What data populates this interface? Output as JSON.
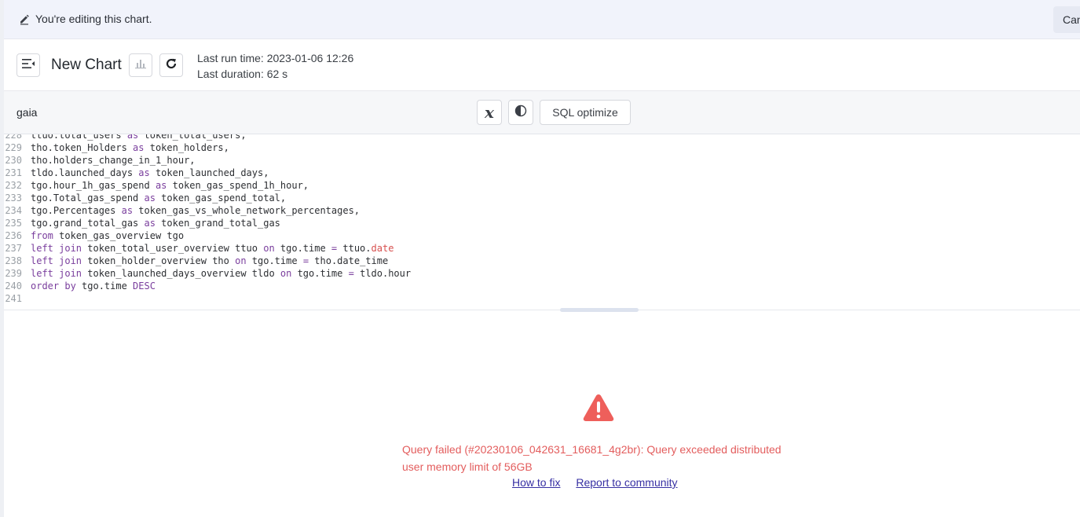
{
  "banner": {
    "text": "You're editing this chart.",
    "cancel_label": "Cancel",
    "icon": "pencil-icon"
  },
  "header": {
    "title": "New Chart",
    "last_run_time": "Last run time: 2023-01-06 12:26",
    "last_duration": "Last duration: 62 s",
    "icons": [
      "sidebar-toggle-icon",
      "bar-chart-icon",
      "refresh-icon"
    ]
  },
  "editor": {
    "database": "gaia",
    "variables_button": "x",
    "theme_button": "contrast-icon",
    "sql_optimize_label": "SQL optimize",
    "lines": [
      {
        "num": "228",
        "tokens": [
          {
            "t": "ttuo.total_users "
          },
          {
            "t": "as",
            "k": "kw"
          },
          {
            "t": " token_total_users,"
          }
        ]
      },
      {
        "num": "229",
        "tokens": [
          {
            "t": "tho.token_Holders "
          },
          {
            "t": "as",
            "k": "kw"
          },
          {
            "t": " token_holders,"
          }
        ]
      },
      {
        "num": "230",
        "tokens": [
          {
            "t": "tho.holders_change_in_1_hour,"
          }
        ]
      },
      {
        "num": "231",
        "tokens": [
          {
            "t": "tldo.launched_days "
          },
          {
            "t": "as",
            "k": "kw"
          },
          {
            "t": " token_launched_days,"
          }
        ]
      },
      {
        "num": "232",
        "tokens": [
          {
            "t": "tgo.hour_1h_gas_spend "
          },
          {
            "t": "as",
            "k": "kw"
          },
          {
            "t": " token_gas_spend_1h_hour,"
          }
        ]
      },
      {
        "num": "233",
        "tokens": [
          {
            "t": "tgo.Total_gas_spend "
          },
          {
            "t": "as",
            "k": "kw"
          },
          {
            "t": " token_gas_spend_total,"
          }
        ]
      },
      {
        "num": "234",
        "tokens": [
          {
            "t": "tgo.Percentages "
          },
          {
            "t": "as",
            "k": "kw"
          },
          {
            "t": " token_gas_vs_whole_network_percentages,"
          }
        ]
      },
      {
        "num": "235",
        "tokens": [
          {
            "t": "tgo.grand_total_gas "
          },
          {
            "t": "as",
            "k": "kw"
          },
          {
            "t": " token_grand_total_gas"
          }
        ]
      },
      {
        "num": "236",
        "tokens": [
          {
            "t": "from",
            "k": "kw"
          },
          {
            "t": " token_gas_overview tgo"
          }
        ]
      },
      {
        "num": "237",
        "tokens": [
          {
            "t": "left join",
            "k": "kw"
          },
          {
            "t": " token_total_user_overview ttuo "
          },
          {
            "t": "on",
            "k": "kw"
          },
          {
            "t": " tgo.time "
          },
          {
            "t": "=",
            "k": "kw"
          },
          {
            "t": " ttuo."
          },
          {
            "t": "date",
            "k": "str"
          }
        ]
      },
      {
        "num": "238",
        "tokens": [
          {
            "t": "left join",
            "k": "kw"
          },
          {
            "t": " token_holder_overview tho "
          },
          {
            "t": "on",
            "k": "kw"
          },
          {
            "t": " tgo.time "
          },
          {
            "t": "=",
            "k": "kw"
          },
          {
            "t": " tho.date_time"
          }
        ]
      },
      {
        "num": "239",
        "tokens": [
          {
            "t": "left join",
            "k": "kw"
          },
          {
            "t": " token_launched_days_overview tldo "
          },
          {
            "t": "on",
            "k": "kw"
          },
          {
            "t": " tgo.time "
          },
          {
            "t": "=",
            "k": "kw"
          },
          {
            "t": " tldo.hour"
          }
        ]
      },
      {
        "num": "240",
        "tokens": [
          {
            "t": "order by",
            "k": "kw"
          },
          {
            "t": " tgo.time "
          },
          {
            "t": "DESC",
            "k": "kw"
          }
        ]
      },
      {
        "num": "241",
        "tokens": []
      }
    ]
  },
  "result": {
    "error_icon": "warning-triangle-icon",
    "error_message": "Query failed (#20230106_042631_16681_4g2br): Query exceeded distributed user memory limit of 56GB",
    "how_to_fix_label": "How to fix",
    "report_label": "Report to community"
  },
  "colors": {
    "accent": "#3730a3",
    "error": "#e35d5d",
    "keyword": "#7a3e9d",
    "string": "#d7504f",
    "banner_bg": "#f1f3fb"
  }
}
